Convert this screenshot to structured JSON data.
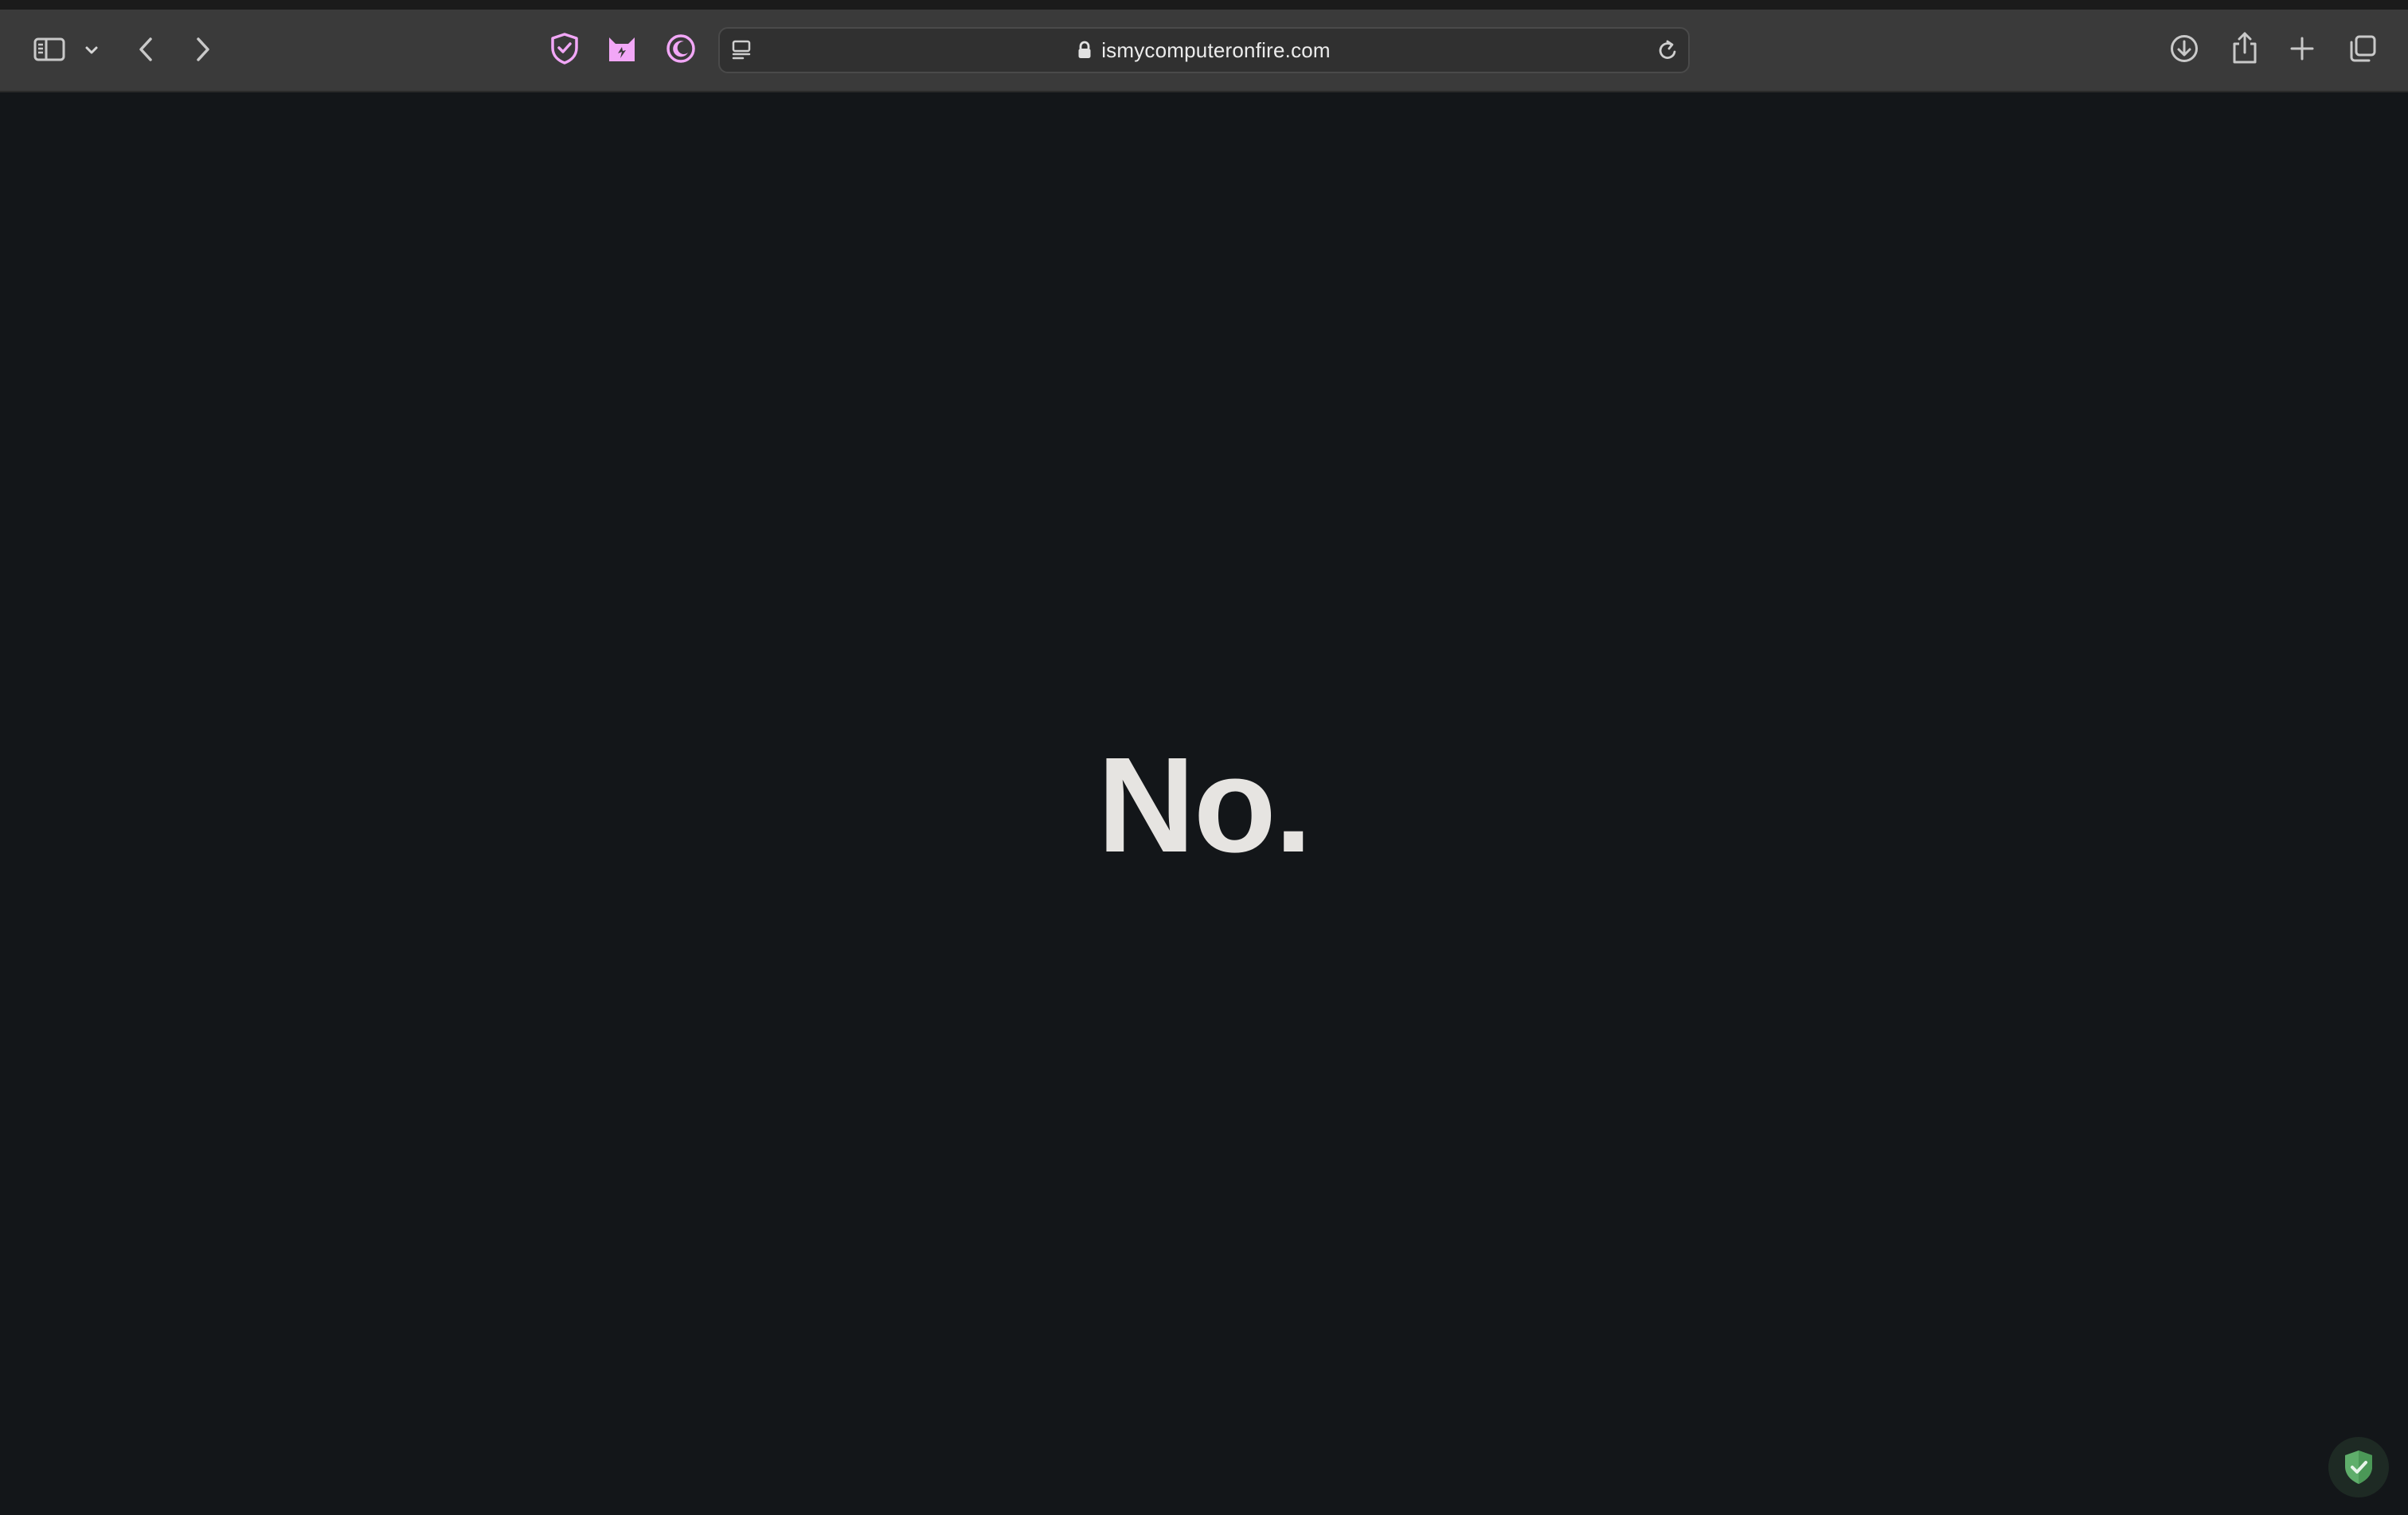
{
  "browser": {
    "address_bar": {
      "url": "ismycomputeronfire.com"
    },
    "toolbar_icons": [
      "sidebar-icon",
      "chevron-down-icon",
      "back-icon",
      "forward-icon",
      "privacy-shield-icon",
      "extension-cat-icon",
      "dark-mode-moon-icon",
      "reader-mode-icon",
      "lock-icon",
      "reload-icon",
      "download-icon",
      "share-icon",
      "new-tab-icon",
      "tab-overview-icon"
    ],
    "colors": {
      "toolbar_bg": "#3a3a3a",
      "extension_accent": "#f2a7f7",
      "page_bg": "#131619",
      "text": "#e6e4e1",
      "badge_green": "#5fae6b"
    }
  },
  "page": {
    "answer": "No."
  },
  "badge": {
    "icon": "shield-check-icon"
  }
}
